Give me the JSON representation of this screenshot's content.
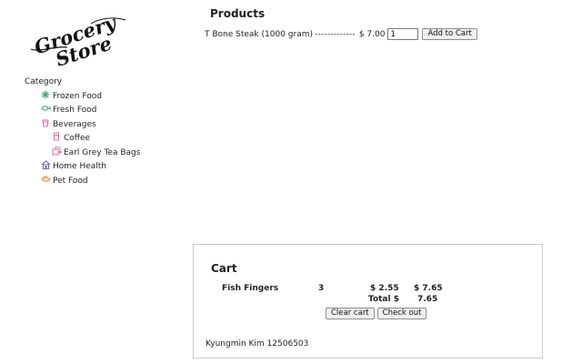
{
  "logo": {
    "line1": "Grocery",
    "line2": "Store"
  },
  "category": {
    "heading": "Category",
    "items": [
      {
        "label": "Frozen Food",
        "icon": "snowflake-icon",
        "color": "#3aa56b"
      },
      {
        "label": "Fresh Food",
        "icon": "fish-icon",
        "color": "#3aa56b"
      },
      {
        "label": "Beverages",
        "icon": "cup-icon",
        "color": "#e46aa6",
        "children": [
          {
            "label": "Coffee",
            "icon": "coffee-pot-icon",
            "color": "#e46aa6"
          },
          {
            "label": "Earl Grey Tea Bags",
            "icon": "tea-bag-icon",
            "color": "#e46aa6"
          }
        ]
      },
      {
        "label": "Home Health",
        "icon": "house-icon",
        "color": "#6a5bc4"
      },
      {
        "label": "Pet Food",
        "icon": "pet-bowl-icon",
        "color": "#e58a2a"
      }
    ]
  },
  "products": {
    "heading": "Products",
    "items": [
      {
        "name": "T Bone Steak (1000 gram)",
        "dashes": "-------------",
        "price": "$ 7.00",
        "quantity": "1",
        "button": "Add to Cart"
      }
    ]
  },
  "cart": {
    "heading": "Cart",
    "items": [
      {
        "name": "Fish Fingers",
        "qty": "3",
        "price": "$ 2.55",
        "total": "$ 7.65"
      }
    ],
    "total_label": "Total $",
    "total_value": "7.65",
    "clear_button": "Clear cart",
    "checkout_button": "Check out"
  },
  "footer": {
    "author": "Kyungmin Kim 12506503"
  }
}
